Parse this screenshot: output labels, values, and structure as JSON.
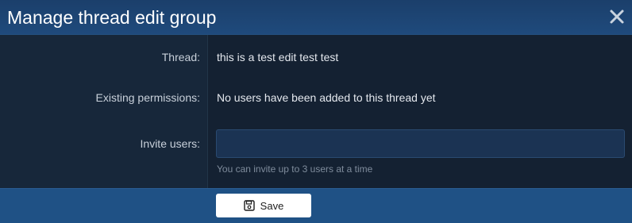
{
  "dialog": {
    "title": "Manage thread edit group",
    "close_icon": "close-icon"
  },
  "form": {
    "thread_label": "Thread:",
    "thread_value": "this is a test edit test test",
    "permissions_label": "Existing permissions:",
    "permissions_value": "No users have been added to this thread yet",
    "invite_label": "Invite users:",
    "invite_value": "",
    "invite_hint": "You can invite up to 3 users at a time"
  },
  "footer": {
    "save_label": "Save",
    "save_icon": "floppy-disk-icon"
  },
  "colors": {
    "titlebar": "#1f4a7c",
    "footer": "#1f5185",
    "input_bg": "#1b3353"
  }
}
